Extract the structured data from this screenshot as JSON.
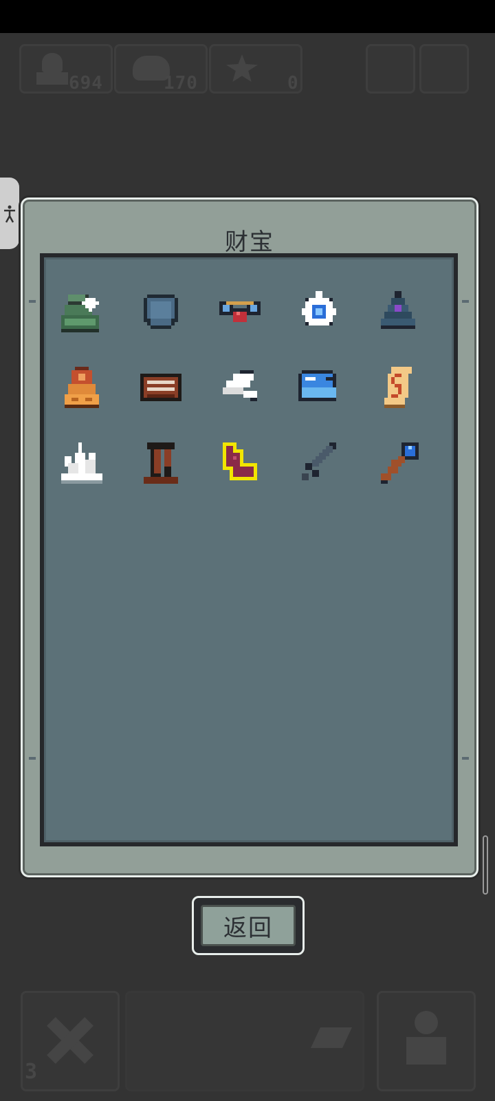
{
  "dialog": {
    "title": "财宝"
  },
  "back_button": {
    "label": "返回"
  },
  "hud": {
    "population": "694",
    "coins": "170",
    "stars": "0",
    "cards_left": "3"
  },
  "treasures": [
    {
      "icon": "green-shrine-icon"
    },
    {
      "icon": "stone-shield-icon"
    },
    {
      "icon": "winged-ruby-icon"
    },
    {
      "icon": "sapphire-amulet-icon"
    },
    {
      "icon": "dark-pagoda-icon"
    },
    {
      "icon": "amber-idol-icon"
    },
    {
      "icon": "wooden-chest-icon"
    },
    {
      "icon": "white-wing-icon"
    },
    {
      "icon": "blue-whale-icon"
    },
    {
      "icon": "ancient-scroll-icon"
    },
    {
      "icon": "crystal-cluster-icon"
    },
    {
      "icon": "broken-totem-icon"
    },
    {
      "icon": "crimson-boot-icon"
    },
    {
      "icon": "steel-sword-icon"
    },
    {
      "icon": "orb-staff-icon"
    }
  ],
  "colors": {
    "panel": "#929f98",
    "inner": "#5c7178",
    "frame": "#26282b",
    "highlight": "#f2e500"
  }
}
